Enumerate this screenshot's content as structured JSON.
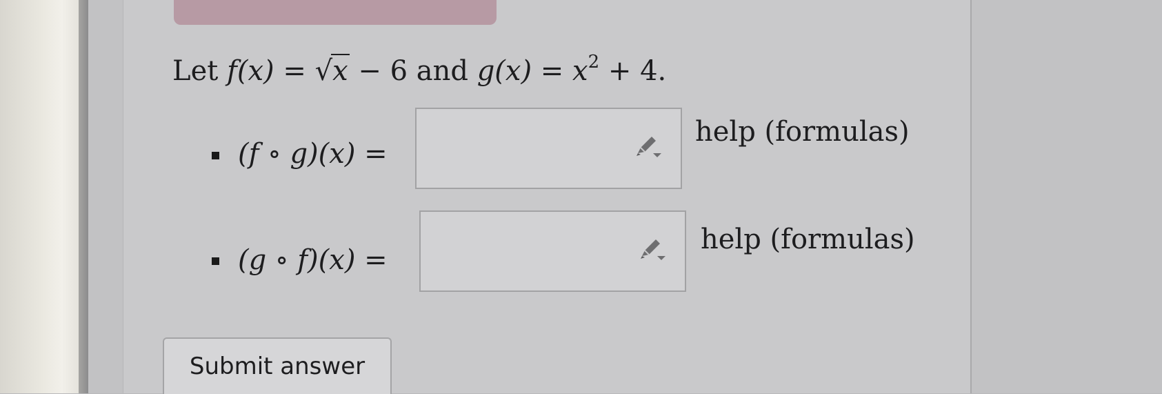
{
  "problem": {
    "prefix": "Let ",
    "f_lhs": "f(x)",
    "eq": " = ",
    "sqrt_arg": "x",
    "f_rest": " − 6",
    "and": " and ",
    "g_lhs": "g(x)",
    "g_base": "x",
    "g_exp": "2",
    "g_rest": " + 4."
  },
  "questions": [
    {
      "label": "(f ∘ g)(x) =",
      "value": "",
      "help_label": "help (formulas)"
    },
    {
      "label": "(g ∘ f)(x) =",
      "value": "",
      "help_label": "help (formulas)"
    }
  ],
  "icons": {
    "edit": "pencil-dropdown-icon"
  },
  "submit_label": "Submit answer"
}
